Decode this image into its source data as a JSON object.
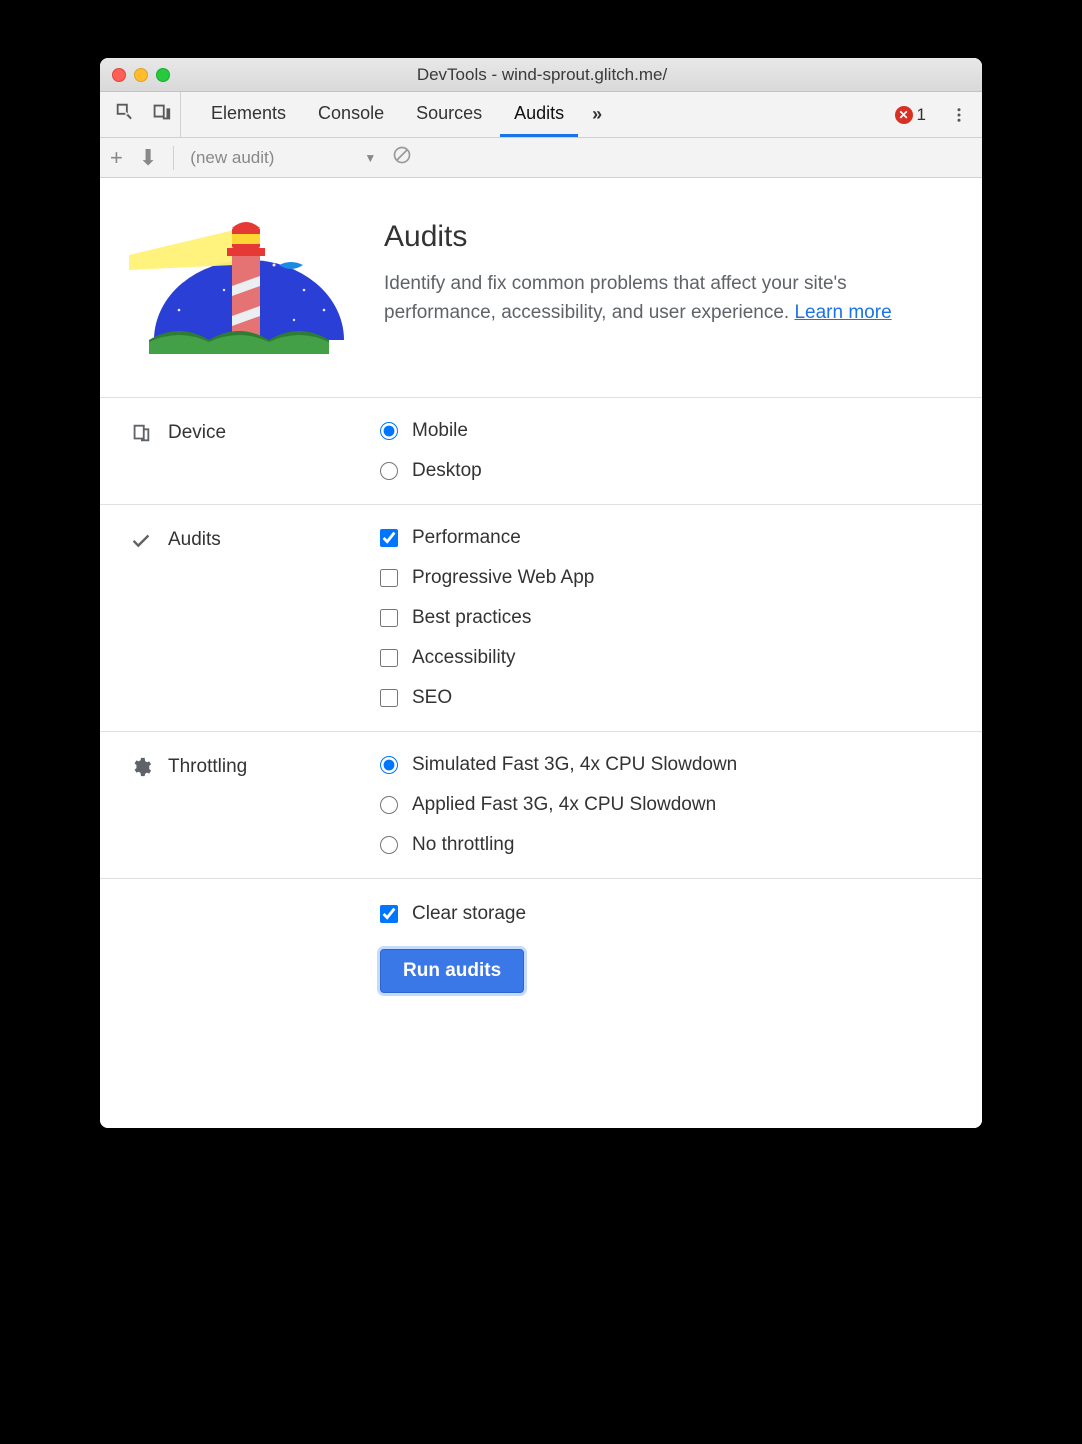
{
  "window": {
    "title": "DevTools - wind-sprout.glitch.me/"
  },
  "tabs": {
    "items": [
      {
        "label": "Elements",
        "active": false
      },
      {
        "label": "Console",
        "active": false
      },
      {
        "label": "Sources",
        "active": false
      },
      {
        "label": "Audits",
        "active": true
      }
    ],
    "more_glyph": "»",
    "errors": {
      "count": "1"
    }
  },
  "toolbar": {
    "dropdown_label": "(new audit)"
  },
  "hero": {
    "heading": "Audits",
    "desc_prefix": "Identify and fix common problems that affect your site's performance, accessibility, and user experience. ",
    "learn_more": "Learn more"
  },
  "sections": {
    "device": {
      "label": "Device",
      "options": [
        {
          "label": "Mobile",
          "selected": true
        },
        {
          "label": "Desktop",
          "selected": false
        }
      ]
    },
    "audits": {
      "label": "Audits",
      "options": [
        {
          "label": "Performance",
          "checked": true
        },
        {
          "label": "Progressive Web App",
          "checked": false
        },
        {
          "label": "Best practices",
          "checked": false
        },
        {
          "label": "Accessibility",
          "checked": false
        },
        {
          "label": "SEO",
          "checked": false
        }
      ]
    },
    "throttling": {
      "label": "Throttling",
      "options": [
        {
          "label": "Simulated Fast 3G, 4x CPU Slowdown",
          "selected": true
        },
        {
          "label": "Applied Fast 3G, 4x CPU Slowdown",
          "selected": false
        },
        {
          "label": "No throttling",
          "selected": false
        }
      ]
    }
  },
  "footer": {
    "clear_storage": {
      "label": "Clear storage",
      "checked": true
    },
    "run_button": "Run audits"
  }
}
